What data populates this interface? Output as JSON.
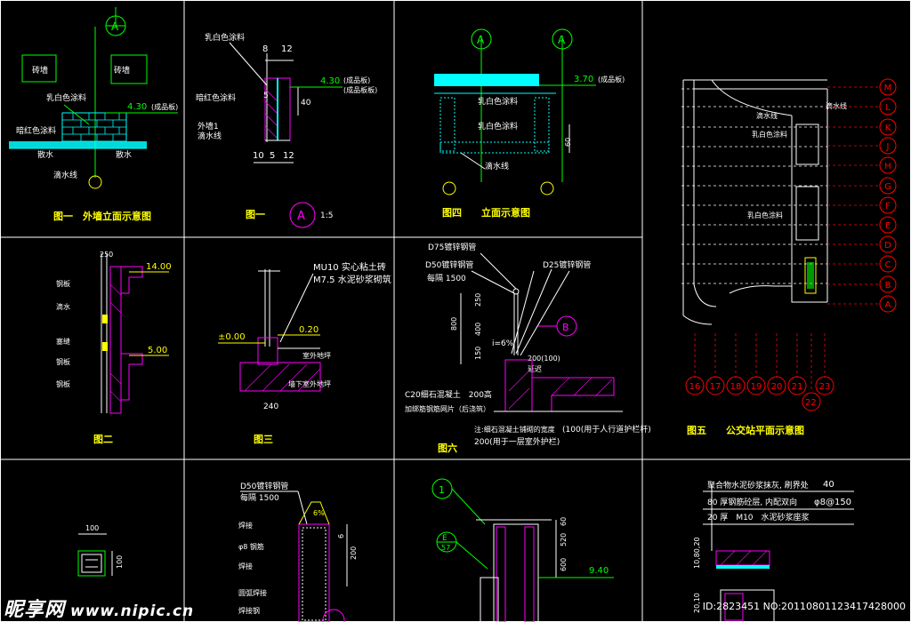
{
  "colors": {
    "background": "#000000",
    "frame": "#ffffff",
    "cyan": "#00ffff",
    "magenta": "#ff00ff",
    "yellow": "#ffff00",
    "green": "#00ff00",
    "red": "#ff0000",
    "white": "#ffffff"
  },
  "captions": {
    "fig1a": "图一　外墙立面示意图",
    "fig1b": "图一",
    "scale": "1:5",
    "fig4": "图四　　立面示意图",
    "fig5": "图五　　公交站平面示意图",
    "fig2": "图二",
    "fig3": "图三",
    "fig6": "图六"
  },
  "axes": {
    "a": "A",
    "e": "E",
    "e_ref": "57",
    "one": "1",
    "b": "B",
    "mark_a": "A"
  },
  "grid_letters": [
    "M",
    "L",
    "K",
    "J",
    "H",
    "G",
    "F",
    "E",
    "D",
    "C",
    "B",
    "A"
  ],
  "grid_numbers": [
    "16",
    "17",
    "18",
    "19",
    "20",
    "21",
    "23"
  ],
  "grid_number_low": "22",
  "panel1": {
    "brick": "砖墙",
    "paint": "乳白色涂料",
    "red": "暗红色涂料",
    "slope": "散水",
    "drain": "滴水线",
    "elev": "4.30",
    "elev_note": "(成品板)"
  },
  "panel2": {
    "paint": "乳白色涂料",
    "paint2": "暗红色涂料",
    "wall1": "外墙1",
    "wall2": "滴水线",
    "d1": "8",
    "d2": "12",
    "d3": "5",
    "d4": "10",
    "d5": "5",
    "d6": "12",
    "h": "40",
    "elev": "4.30",
    "note1": "(成品板)",
    "note2": "(成品板板)"
  },
  "panel3": {
    "elev": "3.70",
    "note": "(成品板)",
    "paint1": "乳白色涂料",
    "paint2": "乳白色涂料",
    "drain": "滴水线",
    "h": "60"
  },
  "panel4": {
    "top": "250",
    "elev1": "14.00",
    "elev2": "5.00",
    "lbl1": "钢板",
    "lbl2": "滴水",
    "lbl3": "塞缝",
    "lbl4": "钢板",
    "lbl5": "钢板"
  },
  "panel5": {
    "line1": "MU10 实心粘土砖",
    "line2": "M7.5 水泥砂浆砌筑",
    "zero": "±0.00",
    "elev": "0.20",
    "wall": "室外地坪",
    "base": "墙下室外地坪",
    "w": "240"
  },
  "panel6": {
    "pipe1": "D75镀锌钢管",
    "pipe2": "D50镀锌钢管",
    "pipe3": "D25镀锌钢管",
    "spacing": "每隔 1500",
    "h1": "800",
    "h2": "250",
    "h3": "400",
    "h4": "150",
    "slope": "i=6%",
    "dim": "200(100)",
    "dim2": "延迟",
    "concrete": "C20细石混凝土　200高",
    "conc2": "加绑筋钢筋网片（后浇筑）",
    "note1": "注:细石混凝土铺砌的宽度",
    "note2": "(100(用于人行道护栏杆)",
    "note3": "200(用于一层室外护栏)"
  },
  "panel7": {
    "w": "100"
  },
  "panel8": {
    "pipe": "D50镀锌钢管",
    "spacing": "每隔 1500",
    "l1": "焊接",
    "l2": "φ8 钢筋",
    "l3": "焊接",
    "l4": "圆弧焊接",
    "l5": "焊接钢",
    "h": "200",
    "top": "6"
  },
  "panel9": {
    "h1": "60",
    "h2": "520",
    "h3": "600",
    "elev": "9.40"
  },
  "panel10": {
    "row1": "聚合物水泥砂浆抹灰, 刷界处",
    "row1v": "40",
    "row2": "80 厚钢筋砼层, 内配双向",
    "row2v": "φ8@150",
    "row3": "20 厚　M10　水泥砂浆座浆",
    "dim": "10,80,20",
    "dim2": "20,10"
  },
  "watermark": {
    "brand": "昵享网",
    "url": "www.nipic.cn",
    "id": "ID:2823451 NO:20110801123417428000"
  }
}
